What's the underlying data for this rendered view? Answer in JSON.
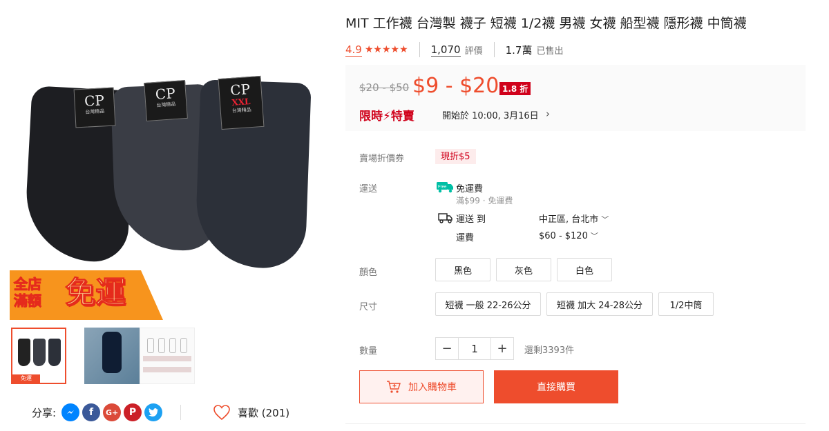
{
  "gallery": {
    "tag_brand": "CP",
    "tag_subtext": "台灣精品",
    "tag_size": "XXL",
    "promo_banner": {
      "line1": "全店",
      "line2": "滿額",
      "big": "免運"
    },
    "thumb_banner": "免運"
  },
  "share": {
    "label": "分享:"
  },
  "like": {
    "label": "喜歡 (201)"
  },
  "product": {
    "title": "MIT 工作襪 台灣製 襪子 短襪 1/2襪 男襪 女襪 船型襪 隱形襪 中筒襪",
    "rating": "4.9",
    "stars": "★★★★★",
    "reviews_count": "1,070",
    "reviews_label": "評價",
    "sold_count": "1.7萬",
    "sold_label": "已售出"
  },
  "price": {
    "original": "$20 - $50",
    "current": "$9 - $20",
    "discount": "1.8 折",
    "flash_label": "限時⚡特賣",
    "flash_start": "開始於 10:00, 3月16日"
  },
  "voucher": {
    "label": "賣場折價券",
    "value": "現折$5"
  },
  "shipping": {
    "label": "運送",
    "free_title": "免運費",
    "free_sub": "滿$99 · 免運費",
    "ship_to_label": "運送 到",
    "ship_to_value": "中正區, 台北市",
    "fee_label": "運費",
    "fee_value": "$60 - $120"
  },
  "color": {
    "label": "顏色",
    "options": [
      "黑色",
      "灰色",
      "白色"
    ]
  },
  "size": {
    "label": "尺寸",
    "options": [
      "短襪 一般 22-26公分",
      "短襪 加大 24-28公分",
      "1/2中筒"
    ]
  },
  "quantity": {
    "label": "數量",
    "minus": "−",
    "value": "1",
    "plus": "+",
    "stock": "還剩3393件"
  },
  "actions": {
    "add_to_cart": "加入購物車",
    "buy_now": "直接購買"
  },
  "colors": {
    "accent": "#ee4d2d",
    "flash": "#d0011b"
  }
}
